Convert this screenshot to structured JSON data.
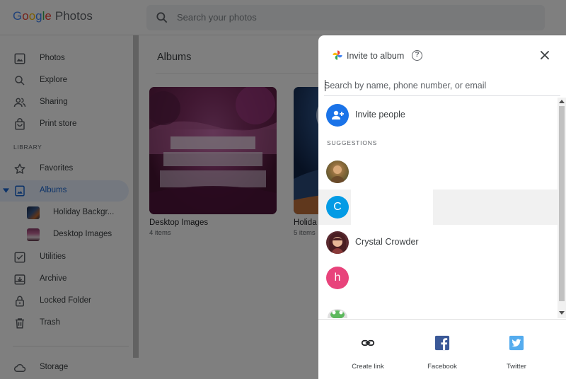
{
  "app": {
    "logo_parts": [
      "G",
      "o",
      "o",
      "g",
      "l",
      "e"
    ],
    "logo_product": "Photos",
    "search_placeholder": "Search your photos"
  },
  "sidebar": {
    "items_top": [
      {
        "label": "Photos",
        "icon": "photo-icon"
      },
      {
        "label": "Explore",
        "icon": "search-icon"
      },
      {
        "label": "Sharing",
        "icon": "people-icon"
      },
      {
        "label": "Print store",
        "icon": "shopping-bag-icon"
      }
    ],
    "library_label": "LIBRARY",
    "items_library": [
      {
        "label": "Favorites",
        "icon": "star-icon"
      },
      {
        "label": "Albums",
        "icon": "album-icon",
        "active": true
      }
    ],
    "album_children": [
      {
        "label": "Holiday Backgr..."
      },
      {
        "label": "Desktop Images"
      }
    ],
    "items_bottom": [
      {
        "label": "Utilities",
        "icon": "checkbox-icon"
      },
      {
        "label": "Archive",
        "icon": "archive-icon"
      },
      {
        "label": "Locked Folder",
        "icon": "lock-icon"
      },
      {
        "label": "Trash",
        "icon": "trash-icon"
      }
    ],
    "storage_label": "Storage"
  },
  "main": {
    "title": "Albums",
    "albums": [
      {
        "name": "Desktop Images",
        "count": "4 items"
      },
      {
        "name": "Holida",
        "count": "5 items"
      }
    ]
  },
  "dialog": {
    "title": "Invite to album",
    "help_glyph": "?",
    "search_placeholder": "Search by name, phone number, or email",
    "invite_label": "Invite people",
    "suggestions_label": "SUGGESTIONS",
    "suggestions": [
      {
        "initial": "",
        "name": ""
      },
      {
        "initial": "C",
        "name": ""
      },
      {
        "initial": "",
        "name": "Crystal Crowder"
      },
      {
        "initial": "h",
        "name": ""
      },
      {
        "initial": "",
        "name": ""
      }
    ],
    "share_options": [
      {
        "label": "Create link",
        "icon": "link-icon"
      },
      {
        "label": "Facebook",
        "icon": "facebook-icon"
      },
      {
        "label": "Twitter",
        "icon": "twitter-icon"
      }
    ]
  },
  "colors": {
    "accent": "#1a73e8",
    "active_bg": "#e8f0fe",
    "avatar_c": "#039be5",
    "avatar_h": "#e8437b",
    "facebook": "#3b5998",
    "twitter": "#55acee"
  }
}
